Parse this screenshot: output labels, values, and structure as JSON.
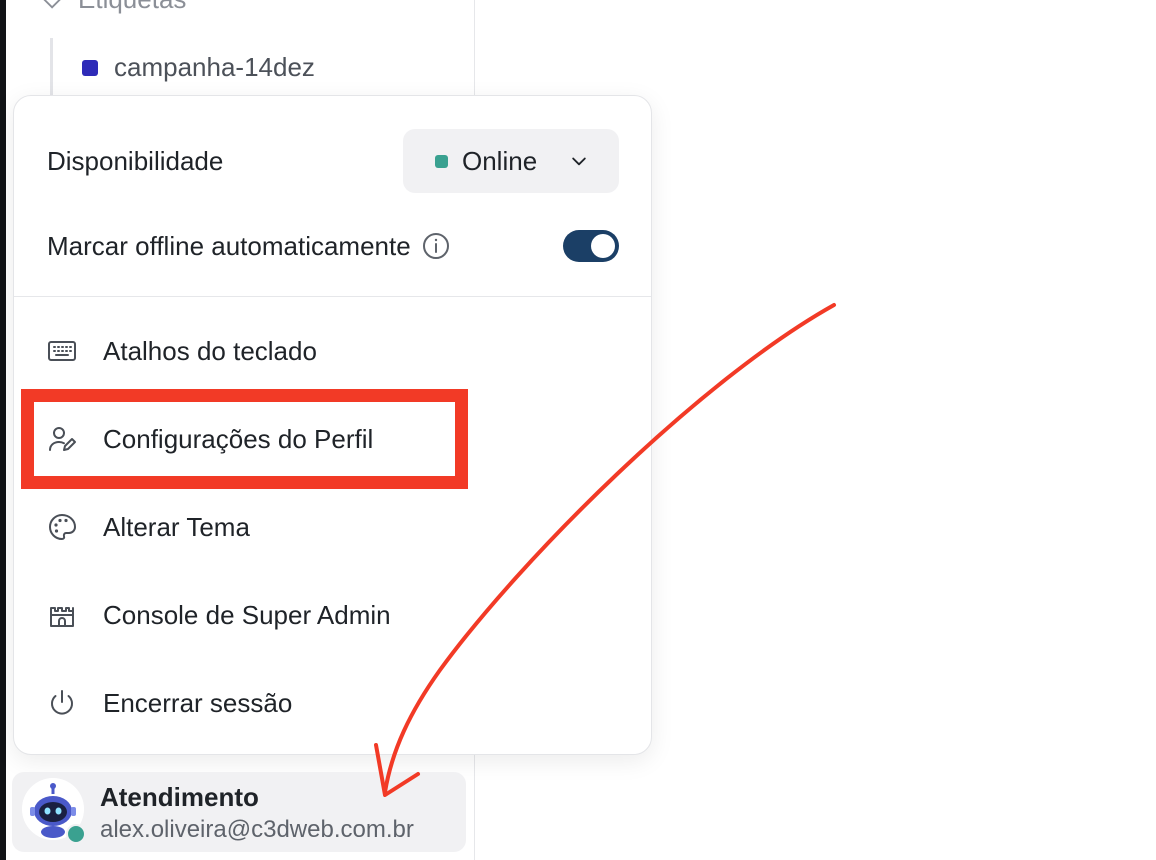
{
  "sidebar": {
    "section_header": "Etiquetas",
    "section_icon": "tag-icon",
    "labels": [
      {
        "name": "campanha-14dez",
        "color": "#2e2bb8"
      }
    ]
  },
  "menu": {
    "availability_label": "Disponibilidade",
    "status": {
      "value": "Online",
      "color": "#3aa190",
      "icon": "chevron-down-icon"
    },
    "auto_offline": {
      "label": "Marcar offline automaticamente",
      "enabled": true,
      "icon": "info-icon"
    },
    "items": [
      {
        "label": "Atalhos do teclado",
        "icon": "keyboard-icon"
      },
      {
        "label": "Configurações do Perfil",
        "icon": "user-edit-icon"
      },
      {
        "label": "Alterar Tema",
        "icon": "palette-icon"
      },
      {
        "label": "Console de Super Admin",
        "icon": "castle-icon"
      },
      {
        "label": "Encerrar sessão",
        "icon": "power-icon"
      }
    ]
  },
  "user": {
    "name": "Atendimento",
    "email": "alex.oliveira@c3dweb.com.br",
    "status_color": "#3aa190"
  },
  "annotation": {
    "highlight_color": "#f23a26",
    "arrow_color": "#f23a26"
  }
}
